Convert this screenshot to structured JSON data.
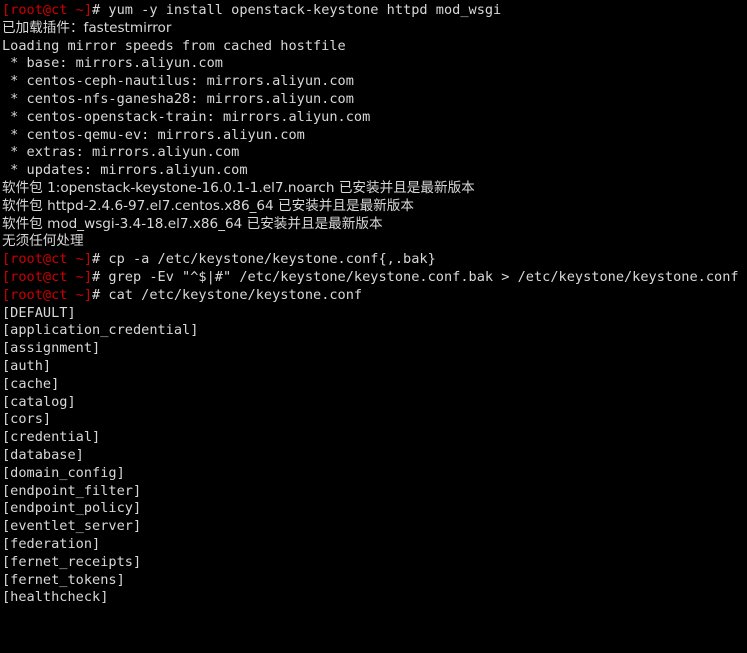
{
  "terminal": {
    "title": "root@ct:~",
    "colors": {
      "background": "#000000",
      "foreground": "#d8d8d8",
      "prompt_red": "#cc0000"
    },
    "prompt": {
      "user_host_path": "[root@ct ~]",
      "symbol": "#"
    },
    "lines": [
      {
        "type": "command",
        "prompt": "[root@ct ~]",
        "symbol": "#",
        "text": " yum -y install openstack-keystone httpd mod_wsgi"
      },
      {
        "type": "output",
        "text": "已加载插件：fastestmirror",
        "cjk": true
      },
      {
        "type": "output",
        "text": "Loading mirror speeds from cached hostfile"
      },
      {
        "type": "output",
        "text": " * base: mirrors.aliyun.com"
      },
      {
        "type": "output",
        "text": " * centos-ceph-nautilus: mirrors.aliyun.com"
      },
      {
        "type": "output",
        "text": " * centos-nfs-ganesha28: mirrors.aliyun.com"
      },
      {
        "type": "output",
        "text": " * centos-openstack-train: mirrors.aliyun.com"
      },
      {
        "type": "output",
        "text": " * centos-qemu-ev: mirrors.aliyun.com"
      },
      {
        "type": "output",
        "text": " * extras: mirrors.aliyun.com"
      },
      {
        "type": "output",
        "text": " * updates: mirrors.aliyun.com"
      },
      {
        "type": "output",
        "text": "软件包 1:openstack-keystone-16.0.1-1.el7.noarch 已安装并且是最新版本",
        "cjk": true
      },
      {
        "type": "output",
        "text": "软件包 httpd-2.4.6-97.el7.centos.x86_64 已安装并且是最新版本",
        "cjk": true
      },
      {
        "type": "output",
        "text": "软件包 mod_wsgi-3.4-18.el7.x86_64 已安装并且是最新版本",
        "cjk": true
      },
      {
        "type": "output",
        "text": "无须任何处理",
        "cjk": true
      },
      {
        "type": "command",
        "prompt": "[root@ct ~]",
        "symbol": "#",
        "text": " cp -a /etc/keystone/keystone.conf{,.bak}"
      },
      {
        "type": "command",
        "prompt": "[root@ct ~]",
        "symbol": "#",
        "text": " grep -Ev \"^$|#\" /etc/keystone/keystone.conf.bak > /etc/keystone/keystone.conf"
      },
      {
        "type": "command",
        "prompt": "[root@ct ~]",
        "symbol": "#",
        "text": " cat /etc/keystone/keystone.conf"
      },
      {
        "type": "output",
        "text": "[DEFAULT]"
      },
      {
        "type": "output",
        "text": "[application_credential]"
      },
      {
        "type": "output",
        "text": "[assignment]"
      },
      {
        "type": "output",
        "text": "[auth]"
      },
      {
        "type": "output",
        "text": "[cache]"
      },
      {
        "type": "output",
        "text": "[catalog]"
      },
      {
        "type": "output",
        "text": "[cors]"
      },
      {
        "type": "output",
        "text": "[credential]"
      },
      {
        "type": "output",
        "text": "[database]"
      },
      {
        "type": "output",
        "text": "[domain_config]"
      },
      {
        "type": "output",
        "text": "[endpoint_filter]"
      },
      {
        "type": "output",
        "text": "[endpoint_policy]"
      },
      {
        "type": "output",
        "text": "[eventlet_server]"
      },
      {
        "type": "output",
        "text": "[federation]"
      },
      {
        "type": "output",
        "text": "[fernet_receipts]"
      },
      {
        "type": "output",
        "text": "[fernet_tokens]"
      },
      {
        "type": "output",
        "text": "[healthcheck]"
      }
    ]
  }
}
